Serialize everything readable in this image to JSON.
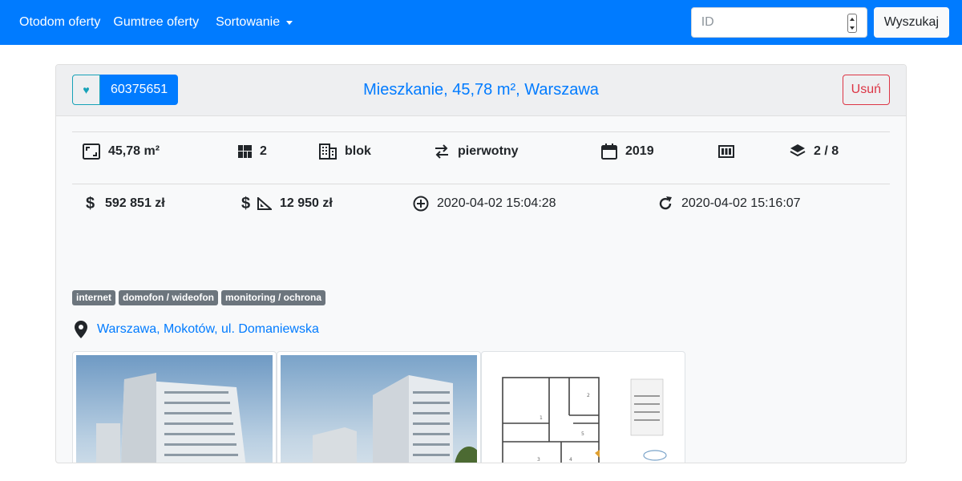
{
  "navbar": {
    "links": {
      "otodom": "Otodom oferty",
      "gumtree": "Gumtree oferty",
      "sort": "Sortowanie"
    },
    "search": {
      "placeholder": "ID",
      "button": "Wyszukaj"
    },
    "bg_color": "#007bff"
  },
  "offer": {
    "id": "60375651",
    "favorite_icon": "heart-icon",
    "title": "Mieszkanie, 45,78 m², Warszawa",
    "delete_label": "Usuń",
    "stats_row1": {
      "area": "45,78 m²",
      "rooms": "2",
      "building_type": "blok",
      "market": "pierwotny",
      "year": "2019",
      "floor": "2 / 8"
    },
    "stats_row2": {
      "price": "592 851 zł",
      "price_per_m2": "12 950 zł",
      "created": "2020-04-02 15:04:28",
      "updated": "2020-04-02 15:16:07"
    },
    "tags": [
      "internet",
      "domofon / wideofon",
      "monitoring / ochrona"
    ],
    "location": "Warszawa, Mokotów, ul. Domaniewska",
    "images": [
      "building-render-1",
      "building-render-2",
      "floor-plan"
    ]
  },
  "colors": {
    "primary": "#007bff",
    "danger": "#dc3545",
    "info": "#17a2b8",
    "badge": "#6c757d"
  }
}
